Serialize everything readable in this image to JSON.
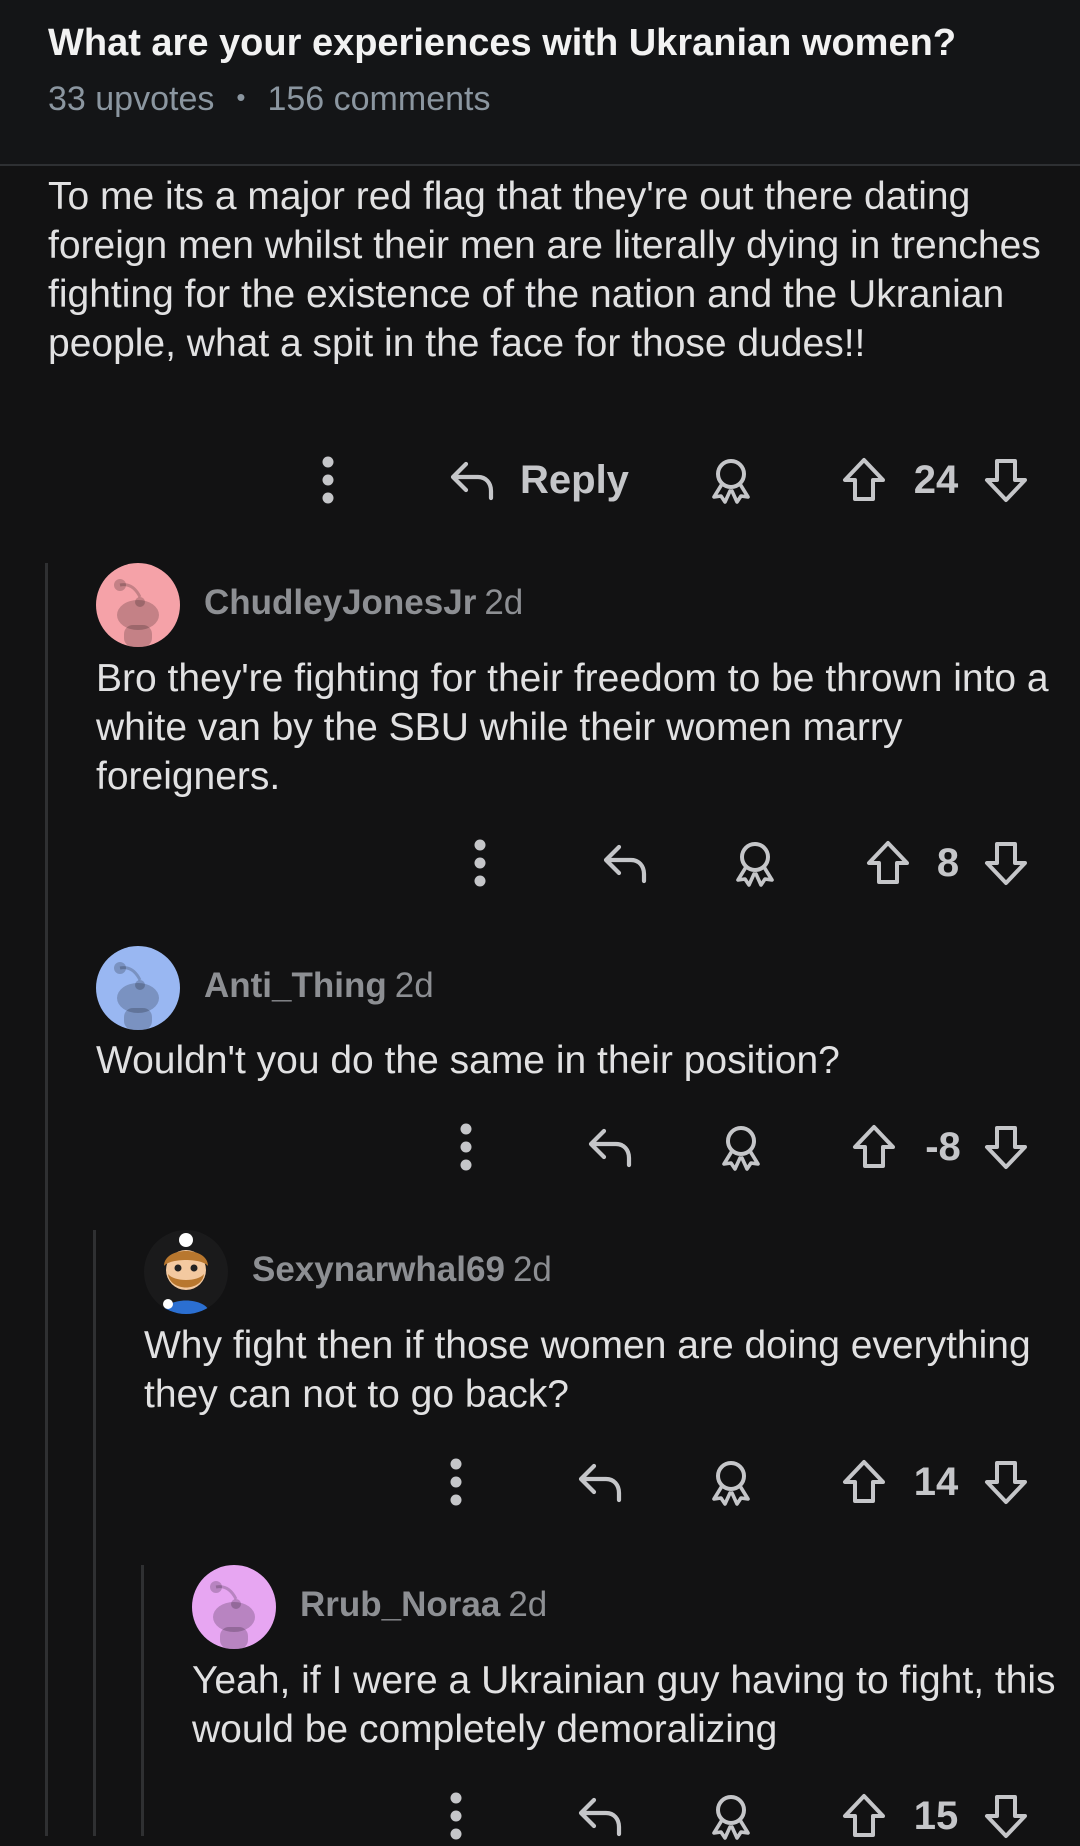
{
  "post": {
    "title": "What are your experiences with Ukranian women?",
    "upvotes": "33 upvotes",
    "separator": "•",
    "comments": "156 comments"
  },
  "top_comment": {
    "body": "To me its a major red flag that they're out there dating foreign men whilst their men are literally dying in trenches fighting for the existence of the nation and the Ukranian people, what a spit in the face for those dudes!!",
    "reply_label": "Reply",
    "score": "24"
  },
  "comments": [
    {
      "author": "ChudleyJonesJr",
      "age": "2d",
      "body": "Bro they're fighting for their freedom to be thrown into a white van by the SBU while their women marry foreigners.",
      "score": "8",
      "avatar_color": "#f5a2a8"
    },
    {
      "author": "Anti_Thing",
      "age": "2d",
      "body": "Wouldn't you do the same in their position?",
      "score": "-8",
      "avatar_color": "#99b7f2"
    },
    {
      "author": "Sexynarwhal69",
      "age": "2d",
      "body": "Why fight then if those women are doing everything they can not to go back?",
      "score": "14",
      "avatar_color": "#1a1a1b"
    },
    {
      "author": "Rrub_Noraa",
      "age": "2d",
      "body": "Yeah, if I were a Ukrainian guy having to fight, this would be completely demoralizing",
      "score": "15",
      "avatar_color": "#e7a6f2"
    }
  ],
  "icons": {
    "more": "more-options-icon",
    "reply": "reply-arrow-icon",
    "award": "award-icon",
    "upvote": "upvote-arrow-icon",
    "downvote": "downvote-arrow-icon"
  },
  "colors": {
    "background": "#121213",
    "text": "#e1e1e2",
    "meta": "#8b96a0",
    "icon": "#c5c6c9",
    "thread_line": "#2f3032"
  }
}
